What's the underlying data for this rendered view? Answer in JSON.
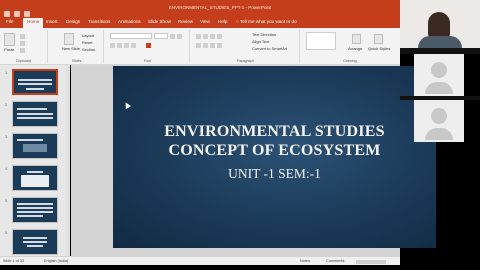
{
  "app": {
    "window_title": "ENVIRONMENTAL_STUDIES_PPT-1 - PowerPoint",
    "tabs": [
      "File",
      "Home",
      "Insert",
      "Design",
      "Transitions",
      "Animations",
      "Slide Show",
      "Review",
      "View",
      "Help"
    ],
    "active_tab": "Home",
    "tell_me": "Tell me what you want to do"
  },
  "ribbon": {
    "clipboard": {
      "paste": "Paste",
      "label": "Clipboard"
    },
    "slides": {
      "new_slide": "New Slide",
      "layout": "Layout",
      "reset": "Reset",
      "section": "Section",
      "label": "Slides"
    },
    "font": {
      "label": "Font"
    },
    "paragraph": {
      "label": "Paragraph",
      "text_direction": "Text Direction",
      "align_text": "Align Text",
      "convert_smartart": "Convert to SmartArt"
    },
    "drawing": {
      "arrange": "Arrange",
      "quick_styles": "Quick Styles",
      "label": "Drawing"
    }
  },
  "thumbnails": [
    {
      "num": "1"
    },
    {
      "num": "2"
    },
    {
      "num": "3"
    },
    {
      "num": "4"
    },
    {
      "num": "5"
    },
    {
      "num": "6"
    }
  ],
  "slide": {
    "title_line1": "ENVIRONMENTAL STUDIES",
    "title_line2": "CONCEPT OF ECOSYSTEM",
    "subtitle": "UNIT -1  SEM:-1",
    "bg_color": "#1b3a58"
  },
  "status": {
    "slide_info": "Slide 1 of 33",
    "language": "English (India)",
    "notes": "Notes",
    "comments": "Comments"
  }
}
